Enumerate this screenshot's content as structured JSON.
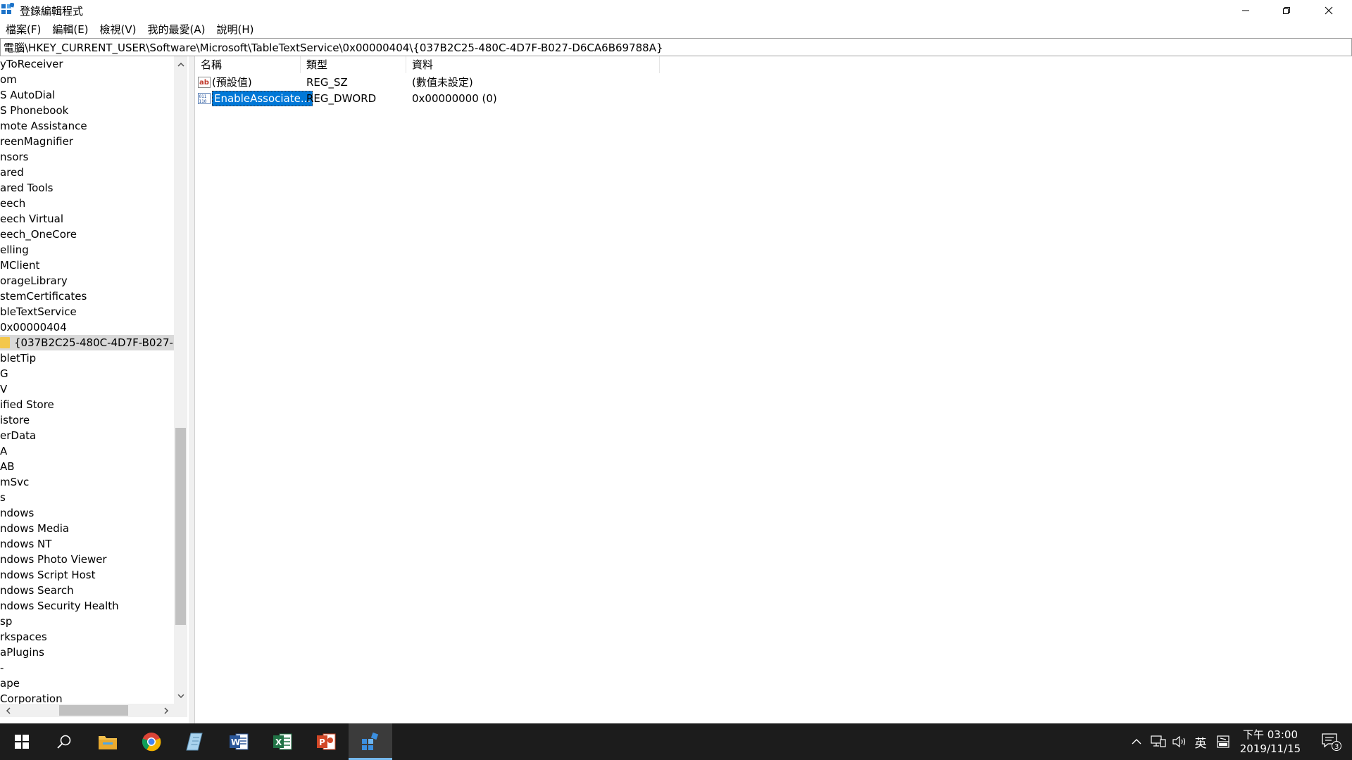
{
  "window": {
    "title": "登錄編輯程式"
  },
  "menu": [
    "檔案(F)",
    "編輯(E)",
    "檢視(V)",
    "我的最愛(A)",
    "說明(H)"
  ],
  "address": "電腦\\HKEY_CURRENT_USER\\Software\\Microsoft\\TableTextService\\0x00000404\\{037B2C25-480C-4D7F-B027-D6CA6B69788A}",
  "tree": {
    "items": [
      "yToReceiver",
      "om",
      "S AutoDial",
      "S Phonebook",
      "mote Assistance",
      "reenMagnifier",
      "nsors",
      "ared",
      "ared Tools",
      "eech",
      "eech Virtual",
      "eech_OneCore",
      "elling",
      "MClient",
      "orageLibrary",
      "stemCertificates",
      "bleTextService",
      "0x00000404",
      "{037B2C25-480C-4D7F-B027-D",
      "bletTip",
      "G",
      "V",
      "ified Store",
      "istore",
      "erData",
      "A",
      "AB",
      "mSvc",
      "s",
      "ndows",
      "ndows Media",
      "ndows NT",
      "ndows Photo Viewer",
      "ndows Script Host",
      "ndows Search",
      "ndows Security Health",
      "sp",
      "rkspaces",
      "aPlugins",
      "-",
      "ape",
      "Corporation"
    ],
    "selected_index": 18
  },
  "values": {
    "columns": [
      "名稱",
      "類型",
      "資料"
    ],
    "rows": [
      {
        "name": "(預設值)",
        "type": "REG_SZ",
        "data": "(數值未設定)",
        "icon": "string-value-icon"
      },
      {
        "name": "EnableAssociate...",
        "type": "REG_DWORD",
        "data": "0x00000000 (0)",
        "icon": "binary-value-icon"
      }
    ],
    "selected_row": 1
  },
  "taskbar": {
    "apps": [
      "start-icon",
      "search-icon",
      "file-explorer-icon",
      "chrome-icon",
      "notepad-icon",
      "word-icon",
      "excel-icon",
      "powerpoint-icon",
      "registry-editor-icon"
    ],
    "ime": "英",
    "time": "下午 03:00",
    "date": "2019/11/15",
    "notification_count": "3"
  },
  "colors": {
    "selection": "#0078d7",
    "taskbar": "#1c1c1c",
    "word": "#2b579a",
    "excel": "#217346",
    "powerpoint": "#d24726"
  }
}
